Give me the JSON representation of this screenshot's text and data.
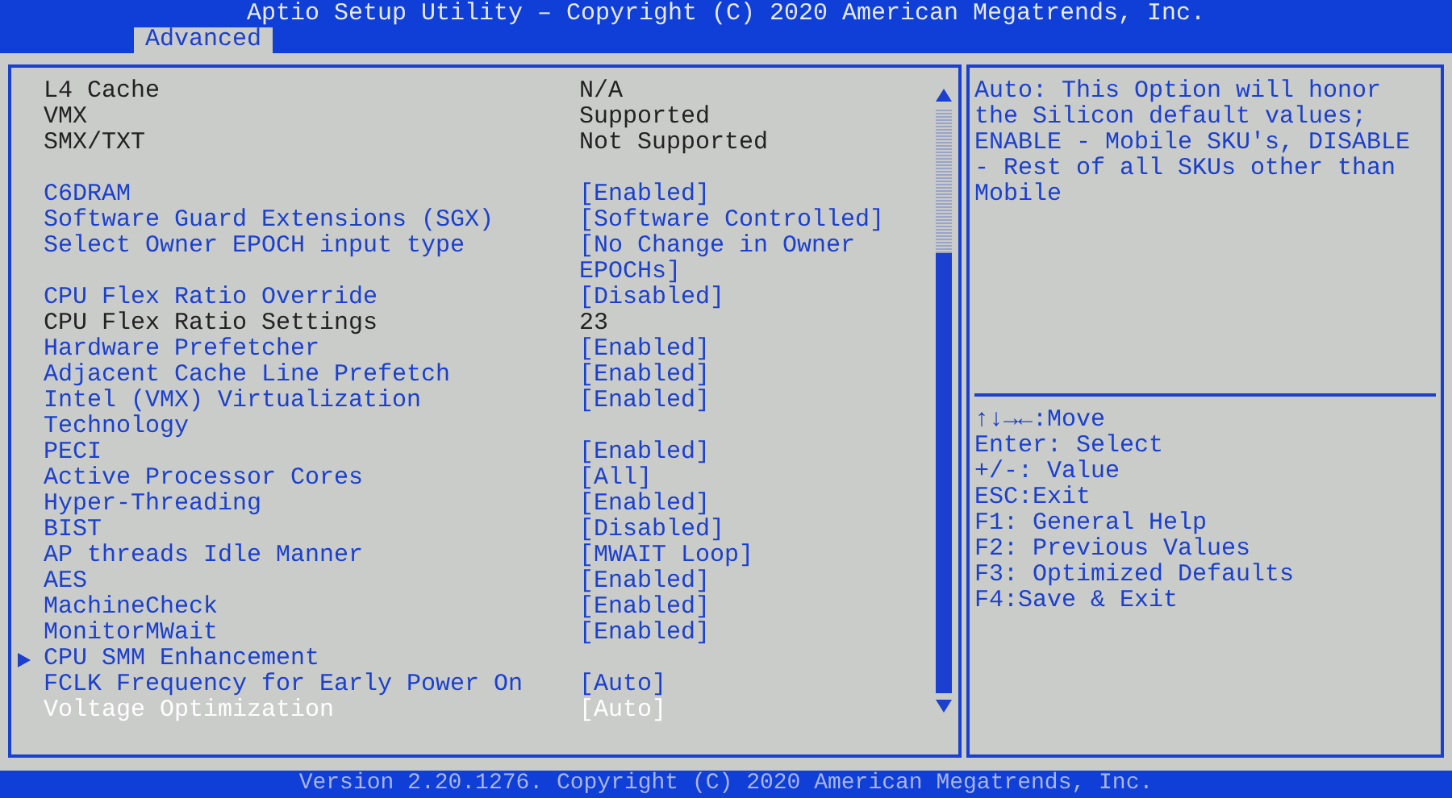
{
  "title": "Aptio Setup Utility – Copyright (C) 2020 American Megatrends, Inc.",
  "tabs": [
    {
      "label": "Advanced",
      "selected": true
    }
  ],
  "settings": [
    {
      "label": "L4 Cache",
      "value": "N/A",
      "kind": "info",
      "selected": false
    },
    {
      "label": "VMX",
      "value": "Supported",
      "kind": "info",
      "selected": false
    },
    {
      "label": "SMX/TXT",
      "value": "Not Supported",
      "kind": "info",
      "selected": false
    },
    {
      "label": "C6DRAM",
      "value": "[Enabled]",
      "kind": "option",
      "selected": false
    },
    {
      "label": "Software Guard Extensions (SGX)",
      "value": "[Software Controlled]",
      "kind": "option",
      "selected": false
    },
    {
      "label": "Select Owner EPOCH input type",
      "value": "[No Change in Owner EPOCHs]",
      "kind": "option",
      "selected": false
    },
    {
      "label": "CPU Flex Ratio Override",
      "value": "[Disabled]",
      "kind": "option",
      "selected": false
    },
    {
      "label": "CPU Flex Ratio Settings",
      "value": "23",
      "kind": "info",
      "selected": false
    },
    {
      "label": "Hardware Prefetcher",
      "value": "[Enabled]",
      "kind": "option",
      "selected": false
    },
    {
      "label": "Adjacent Cache Line Prefetch",
      "value": "[Enabled]",
      "kind": "option",
      "selected": false
    },
    {
      "label": "Intel (VMX) Virtualization Technology",
      "value": "[Enabled]",
      "kind": "option",
      "selected": false
    },
    {
      "label": "PECI",
      "value": "[Enabled]",
      "kind": "option",
      "selected": false
    },
    {
      "label": "Active Processor Cores",
      "value": "[All]",
      "kind": "option",
      "selected": false
    },
    {
      "label": "Hyper-Threading",
      "value": "[Enabled]",
      "kind": "option",
      "selected": false
    },
    {
      "label": "BIST",
      "value": "[Disabled]",
      "kind": "option",
      "selected": false
    },
    {
      "label": "AP threads Idle Manner",
      "value": "[MWAIT Loop]",
      "kind": "option",
      "selected": false
    },
    {
      "label": "AES",
      "value": "[Enabled]",
      "kind": "option",
      "selected": false
    },
    {
      "label": "MachineCheck",
      "value": "[Enabled]",
      "kind": "option",
      "selected": false
    },
    {
      "label": "MonitorMWait",
      "value": "[Enabled]",
      "kind": "option",
      "selected": false
    },
    {
      "label": "CPU SMM Enhancement",
      "kind": "submenu",
      "selected": false
    },
    {
      "label": "FCLK Frequency for Early Power On",
      "value": "[Auto]",
      "kind": "option",
      "selected": false
    },
    {
      "label": "Voltage Optimization",
      "value": "[Auto]",
      "kind": "option",
      "selected": true
    }
  ],
  "help_text": "Auto: This Option will honor the Silicon default values; ENABLE - Mobile SKU's, DISABLE - Rest of all SKUs other than Mobile",
  "key_help": [
    "↑↓→←:Move",
    "Enter: Select",
    "+/-: Value",
    "ESC:Exit",
    "F1: General Help",
    "F2: Previous Values",
    "F3: Optimized Defaults",
    "F4:Save & Exit"
  ],
  "footer": "Version 2.20.1276. Copyright (C) 2020 American Megatrends, Inc."
}
